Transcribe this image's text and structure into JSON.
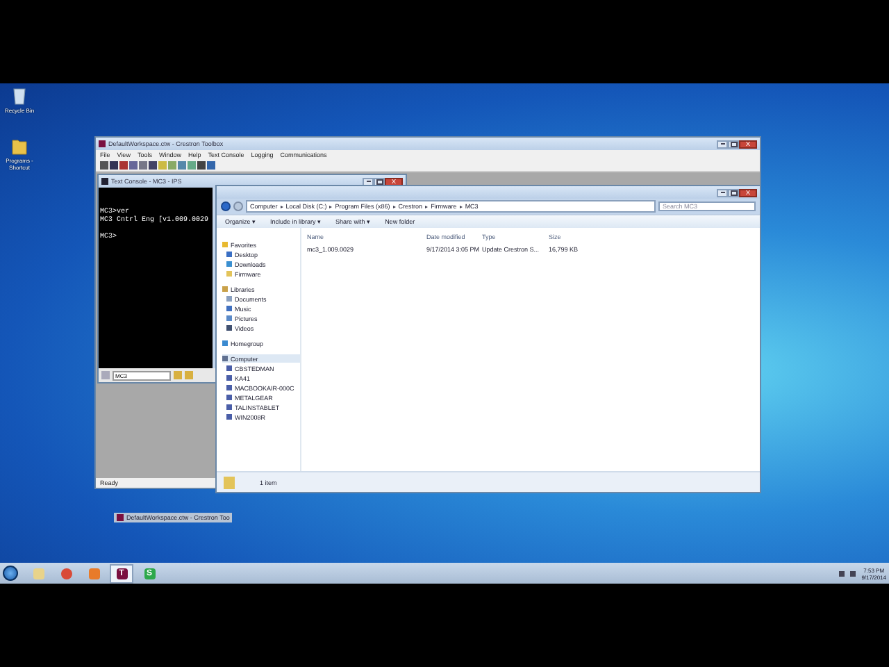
{
  "desktop_icons": [
    {
      "label": "Recycle Bin",
      "kind": "bin"
    },
    {
      "label": "Programs - Shortcut",
      "kind": "folder"
    }
  ],
  "toolbox_window": {
    "title": "DefaultWorkspace.ctw - Crestron Toolbox",
    "menu": [
      "File",
      "View",
      "Tools",
      "Window",
      "Help",
      "Text Console",
      "Logging",
      "Communications"
    ],
    "status": "Ready"
  },
  "text_console": {
    "title": "Text Console - MC3 - IPS",
    "lines": [
      "MC3>ver",
      "MC3 Cntrl Eng [v1.009.0029",
      "MC3>"
    ],
    "device": "MC3"
  },
  "explorer": {
    "breadcrumb": [
      "Computer",
      "Local Disk (C:)",
      "Program Files (x86)",
      "Crestron",
      "Firmware",
      "MC3"
    ],
    "search_placeholder": "Search MC3",
    "toolbar": [
      "Organize ▾",
      "Include in library ▾",
      "Share with ▾",
      "New folder"
    ],
    "nav": [
      {
        "label": "Favorites",
        "kind": "star",
        "selected": false
      },
      {
        "label": "Desktop",
        "kind": "desktop",
        "selected": false
      },
      {
        "label": "Downloads",
        "kind": "download",
        "selected": false
      },
      {
        "label": "Firmware",
        "kind": "folder",
        "selected": false
      },
      {
        "label": "Libraries",
        "kind": "library",
        "selected": false
      },
      {
        "label": "Documents",
        "kind": "document",
        "selected": false
      },
      {
        "label": "Music",
        "kind": "music",
        "selected": false
      },
      {
        "label": "Pictures",
        "kind": "picture",
        "selected": false
      },
      {
        "label": "Videos",
        "kind": "video",
        "selected": false
      },
      {
        "label": "Homegroup",
        "kind": "homegroup",
        "selected": false
      },
      {
        "label": "Computer",
        "kind": "computer",
        "selected": true
      },
      {
        "label": "CBSTEDMAN",
        "kind": "pc",
        "selected": false
      },
      {
        "label": "KA41",
        "kind": "pc",
        "selected": false
      },
      {
        "label": "MACBOOKAIR-000C",
        "kind": "pc",
        "selected": false
      },
      {
        "label": "METALGEAR",
        "kind": "pc",
        "selected": false
      },
      {
        "label": "TALINSTABLET",
        "kind": "pc",
        "selected": false
      },
      {
        "label": "WIN2008R",
        "kind": "pc",
        "selected": false
      }
    ],
    "columns": [
      "Name",
      "Date modified",
      "Type",
      "Size"
    ],
    "rows": [
      {
        "name": "mc3_1.009.0029",
        "date": "9/17/2014 3:05 PM",
        "type": "Update Crestron S...",
        "size": "16,799 KB"
      }
    ],
    "status": "1 item"
  },
  "minimized_window": {
    "title": "DefaultWorkspace.ctw - Crestron Too"
  },
  "taskbar": {
    "apps": [
      {
        "kind": "folder",
        "selected": false
      },
      {
        "kind": "chrome",
        "selected": false
      },
      {
        "kind": "office",
        "selected": false
      },
      {
        "kind": "toolbox",
        "glyph": "T",
        "selected": true
      },
      {
        "kind": "sheet",
        "glyph": "S",
        "selected": false
      }
    ],
    "time": "7:53 PM",
    "date": "9/17/2014"
  }
}
